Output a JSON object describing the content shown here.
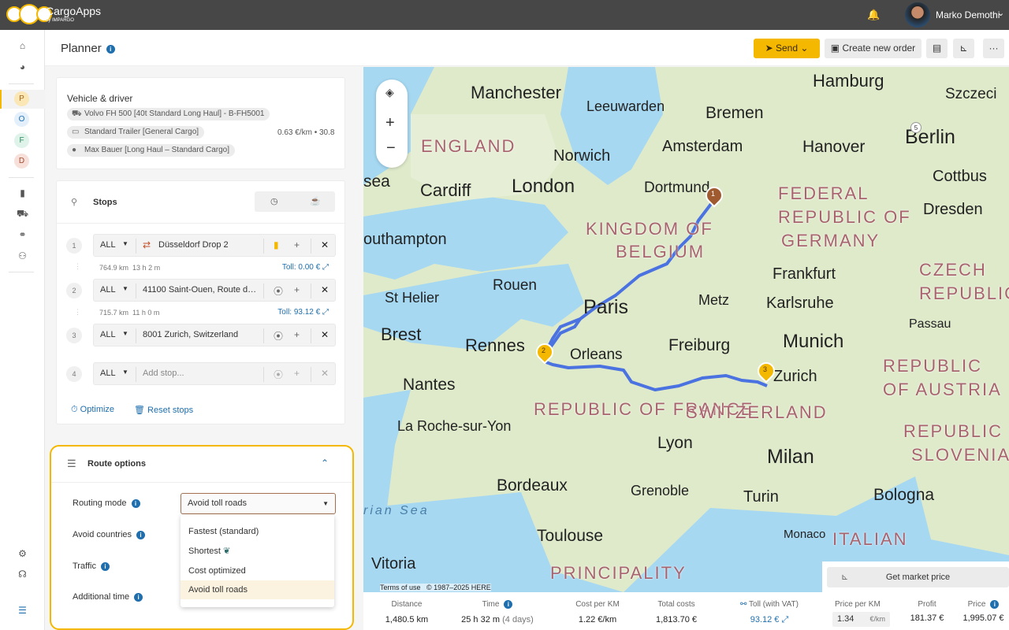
{
  "app": {
    "name": "CargoApps",
    "sub": "by IMPARGO",
    "user": "Marko Demothi"
  },
  "sidebar": {
    "circles": [
      "P",
      "O",
      "F",
      "D"
    ]
  },
  "header": {
    "title": "Planner",
    "send": "Send",
    "create_order": "Create new order",
    "more": "···"
  },
  "vehicle": {
    "title": "Vehicle & driver",
    "truck": "Volvo FH 500 [40t Standard Long Haul] - B-FH5001",
    "trailer": "Standard Trailer [General Cargo]",
    "driver": "Max Bauer [Long Haul – Standard Cargo]",
    "cost": "0.63 €/km • 30.8"
  },
  "stops": {
    "title": "Stops",
    "items": [
      {
        "num": "1",
        "filter": "ALL",
        "text": "Düsseldorf Drop 2"
      },
      {
        "num": "2",
        "filter": "ALL",
        "text": "41100 Saint-Ouen, Route d…"
      },
      {
        "num": "3",
        "filter": "ALL",
        "text": "8001 Zurich, Switzerland"
      },
      {
        "num": "4",
        "filter": "ALL",
        "text": "",
        "placeholder": "Add stop..."
      }
    ],
    "legs": [
      {
        "km": "764.9 km",
        "time": "13 h 2 m",
        "toll": "Toll: 0.00 €"
      },
      {
        "km": "715.7 km",
        "time": "11 h 0 m",
        "toll": "Toll: 93.12 €"
      }
    ],
    "optimize": "Optimize",
    "reset": "Reset stops"
  },
  "route_options": {
    "title": "Routing options",
    "title_label": "Route options",
    "routing_mode_label": "Routing mode",
    "routing_mode_value": "Avoid toll roads",
    "avoid_countries": "Avoid countries",
    "traffic": "Traffic",
    "additional_time": "Additional time",
    "options": [
      "Fastest (standard)",
      "Shortest",
      "Cost optimized",
      "Avoid toll roads"
    ]
  },
  "map": {
    "cities": [
      "Manchester",
      "Leeuwarden",
      "Hamburg",
      "Bremen",
      "Szczeci",
      "Amsterdam",
      "Hanover",
      "Berlin",
      "Norwich",
      "Cardiff",
      "London",
      "Dortmund",
      "Cottbus",
      "Dresden",
      "Frankfurt",
      "Rouen",
      "St Helier",
      "Paris",
      "Metz",
      "Karlsruhe",
      "Passau",
      "Brest",
      "Rennes",
      "Orleans",
      "Freiburg",
      "Munich",
      "Zurich",
      "Nantes",
      "La Roche-sur-Yon",
      "Lyon",
      "Milan",
      "Bordeaux",
      "Grenoble",
      "Turin",
      "Bologna",
      "Toulouse",
      "Monaco",
      "Vitoria",
      "sea",
      "outhampton"
    ],
    "countries": [
      "ENGLAND",
      "FEDERAL",
      "REPUBLIC OF",
      "GERMANY",
      "KINGDOM OF",
      "BELGIUM",
      "CZECH",
      "REPUBLIC",
      "REPUBLIC OF FRANCE",
      "SWITZERLAND",
      "REPUBLIC",
      "OF AUSTRIA",
      "REPUBLIC OF",
      "SLOVENIA",
      "ITALIAN",
      "PRINCIPALITY"
    ],
    "sea": "rian Sea",
    "terms": "Terms of use",
    "copyright": "© 1987–2025 HERE",
    "markers": [
      "1",
      "2",
      "3",
      "5"
    ]
  },
  "summary": {
    "distance_label": "Distance",
    "distance": "1,480.5 km",
    "time_label": "Time",
    "time": "25 h 32 m",
    "time_days": "(4 days)",
    "cpk_label": "Cost per KM",
    "cpk": "1.22 €/km",
    "total_label": "Total costs",
    "total": "1,813.70 €",
    "toll_label": "Toll (with VAT)",
    "toll": "93.12 €"
  },
  "pricing": {
    "market": "Get market price",
    "ppk_label": "Price per KM",
    "ppk": "1.34",
    "ppk_unit": "€/km",
    "profit_label": "Profit",
    "profit": "181.37 €",
    "price_label": "Price",
    "price": "1,995.07 €"
  },
  "colors": {
    "accent": "#f5b800",
    "route": "#4a72e0",
    "link": "#1f6fae"
  }
}
